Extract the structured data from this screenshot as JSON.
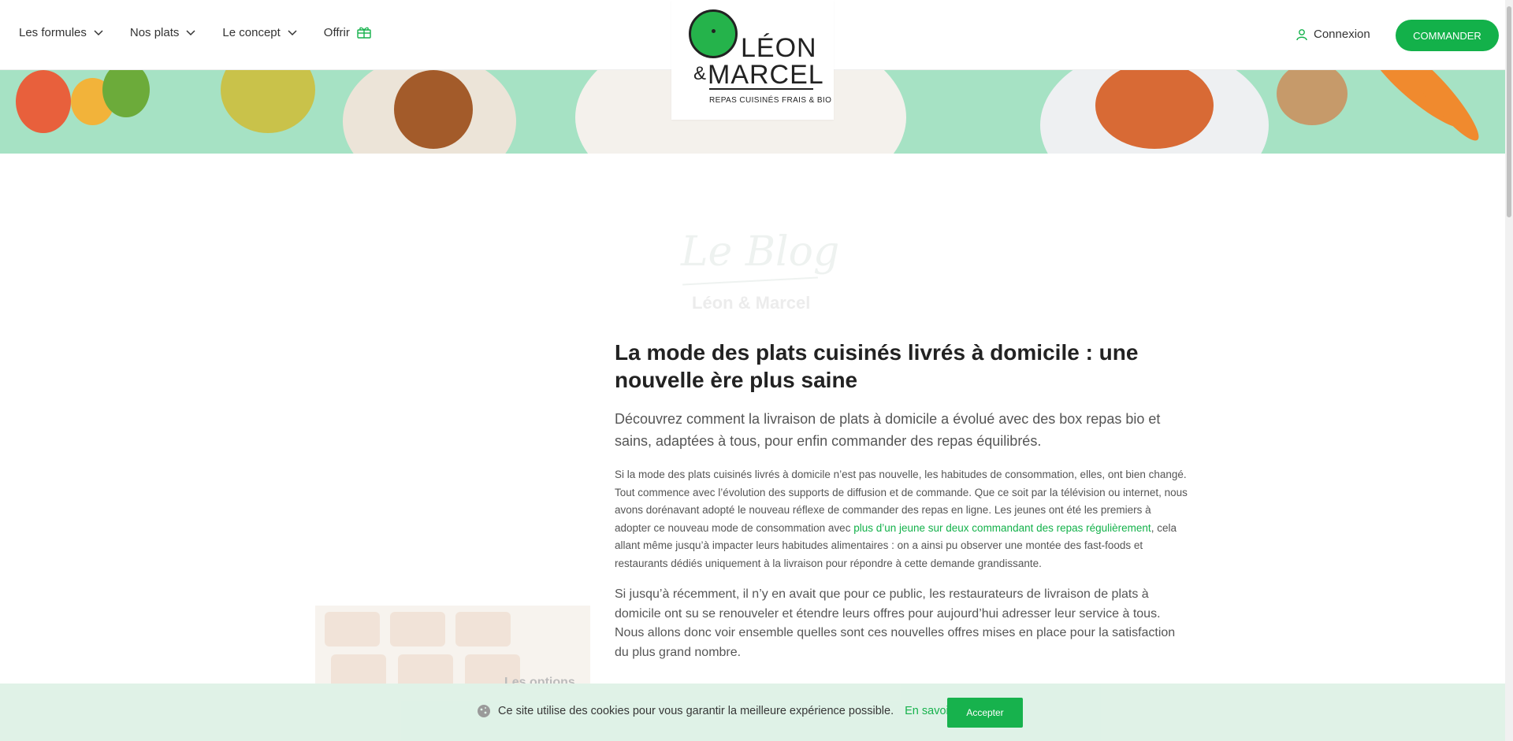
{
  "header": {
    "nav": [
      {
        "label": "Les formules",
        "has_dropdown": true
      },
      {
        "label": "Nos plats",
        "has_dropdown": true
      },
      {
        "label": "Le concept",
        "has_dropdown": true
      },
      {
        "label": "Offrir",
        "icon": "gift-icon"
      }
    ],
    "logo": {
      "leon": "LÉON",
      "amp": "&",
      "marcel": "MARCEL",
      "tagline": "REPAS CUISINÉS FRAIS & BIO"
    },
    "connexion_label": "Connexion",
    "commander_label": "COMMANDER"
  },
  "blog": {
    "script_title": "Le Blog",
    "subtitle": "Léon & Marcel"
  },
  "article": {
    "title": "La mode des plats cuisinés livrés à domicile : une nouvelle ère plus saine",
    "lead": "Découvrez comment la livraison de plats à domicile a évolué avec des box repas bio et sains, adaptées à tous, pour enfin commander des repas équilibrés.",
    "p1_before": "Si la mode des plats cuisinés livrés à domicile n’est pas nouvelle, les habitudes de consommation, elles, ont bien changé. Tout commence avec l’évolution des supports de diffusion et de commande. Que ce soit par la télévision ou internet, nous avons dorénavant adopté le nouveau réflexe de commander des repas en ligne. Les jeunes ont été les premiers à adopter ce nouveau mode de consommation avec ",
    "p1_link": "plus d’un jeune sur deux commandant des repas régulièrement",
    "p1_after": ", cela allant même jusqu’à impacter leurs habitudes alimentaires : on a ainsi pu observer une montée des fast-foods et restaurants dédiés uniquement à la livraison pour répondre à cette demande grandissante.",
    "p2": "Si jusqu’à récemment, il n’y en avait que pour ce public, les restaurateurs de livraison de plats à domicile ont su se renouveler et étendre leurs offres pour aujourd’hui adresser leur service à tous. Nous allons donc voir ensemble quelles sont ces nouvelles offres mises en place pour la satisfaction du plus grand nombre."
  },
  "side_card": {
    "label": "Les options"
  },
  "cookie": {
    "text": "Ce site utilise des cookies pour vous garantir la meilleure expérience possible.",
    "link": "En savoir +",
    "accept": "Accepter"
  },
  "colors": {
    "brand_green": "#13b14a",
    "banner_mint": "#a6e2c4",
    "cookie_bg": "#dff2e7"
  }
}
